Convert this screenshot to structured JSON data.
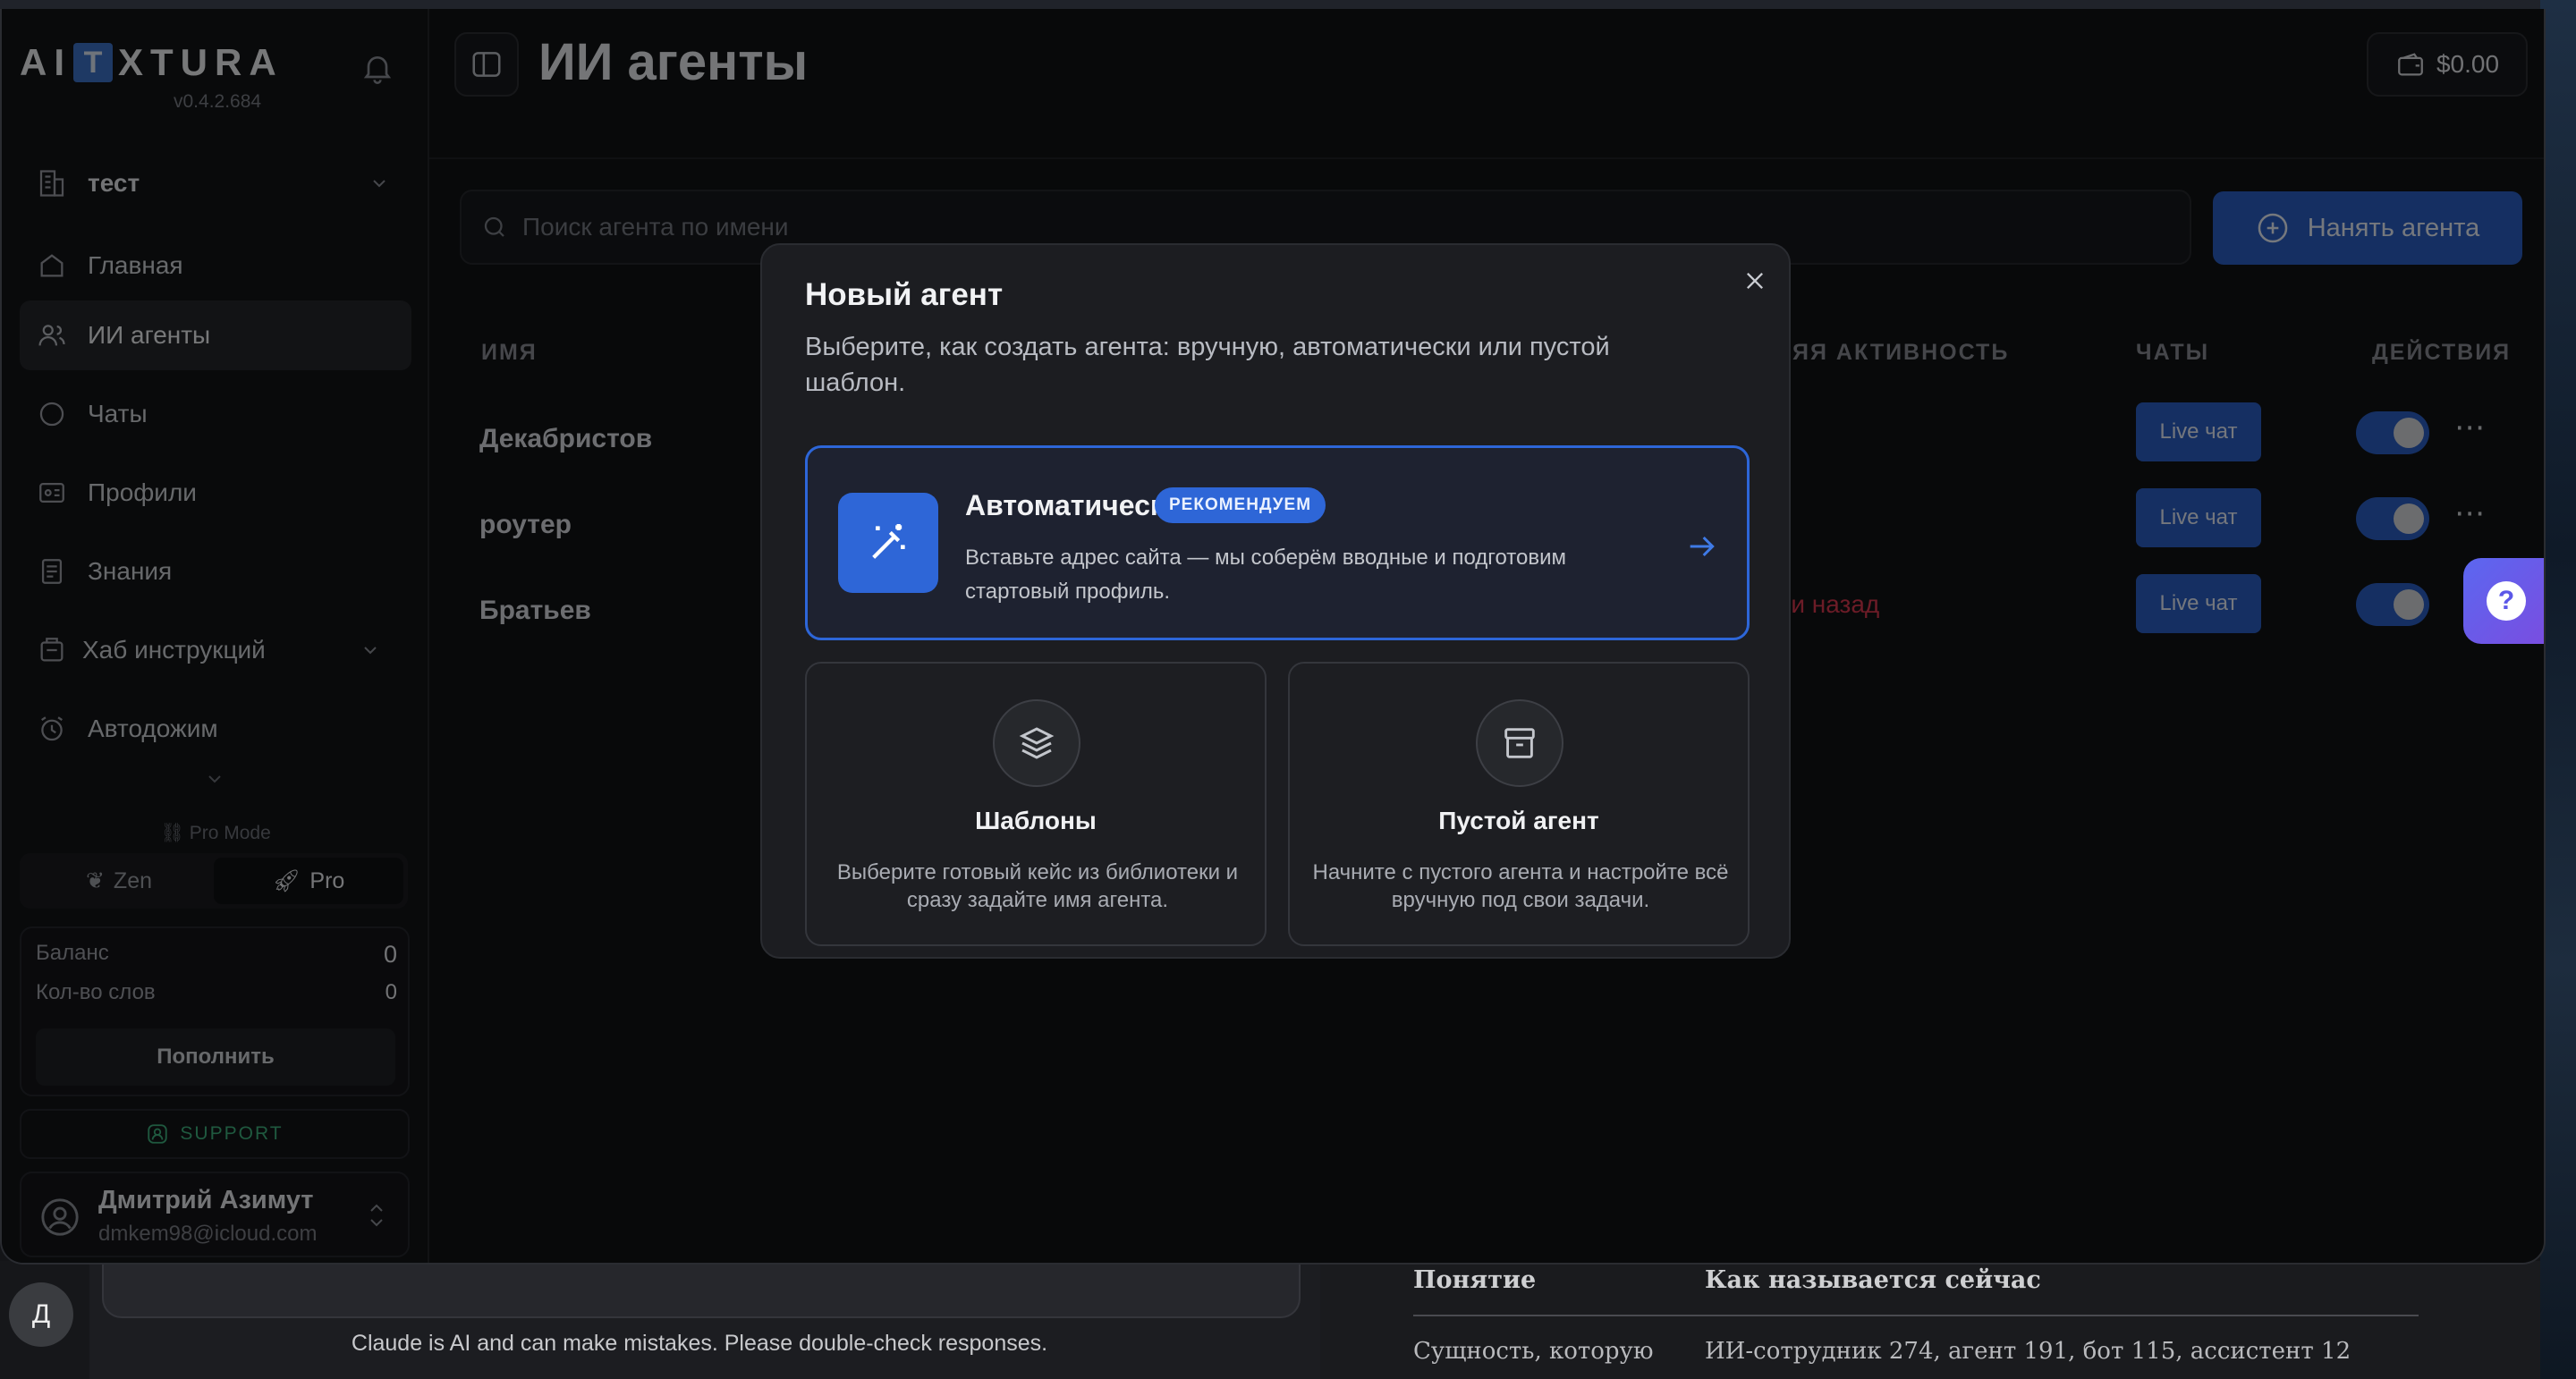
{
  "app": {
    "logo_left": "AI",
    "logo_box": "T",
    "logo_right": "XTURA",
    "version": "v0.4.2.684"
  },
  "sidebar": {
    "workspace": "тест",
    "items": [
      {
        "label": "Главная",
        "icon": "home-icon"
      },
      {
        "label": "ИИ агенты",
        "icon": "users-icon"
      },
      {
        "label": "Чаты",
        "icon": "chat-icon"
      },
      {
        "label": "Профили",
        "icon": "id-card-icon"
      },
      {
        "label": "Знания",
        "icon": "book-icon"
      },
      {
        "label": "Хаб инструкций",
        "icon": "hub-icon"
      },
      {
        "label": "Автодожим",
        "icon": "alarm-icon"
      }
    ],
    "pro_mode": "Pro Mode",
    "mode_zen": "Zen",
    "mode_pro": "Pro",
    "balance_label": "Баланс",
    "balance_value": "0",
    "words_label": "Кол-во слов",
    "words_value": "0",
    "topup": "Пополнить",
    "support": "SUPPORT",
    "user_name": "Дмитрий Азимут",
    "user_email": "dmkem98@icloud.com"
  },
  "header": {
    "title": "ИИ агенты",
    "wallet": "$0.00"
  },
  "search": {
    "placeholder": "Поиск агента по имени"
  },
  "hire_button": "Нанять агента",
  "table": {
    "col_name": "ИМЯ",
    "col_activity": "ЯЯ АКТИВНОСТЬ",
    "col_chats": "ЧАТЫ",
    "col_actions": "ДЕЙСТВИЯ",
    "rows": [
      {
        "name": "Декабристов",
        "chat": "Live чат"
      },
      {
        "name": "роутер",
        "chat": "Live чат"
      },
      {
        "name": "Братьев",
        "chat": "Live чат",
        "activity": "ли назад"
      }
    ]
  },
  "modal": {
    "title": "Новый агент",
    "subtitle": "Выберите, как создать агента: вручную, автоматически или пустой шаблон.",
    "auto_title": "Автоматически",
    "auto_badge": "РЕКОМЕНДУЕМ",
    "auto_desc": "Вставьте адрес сайта — мы соберём вводные и подготовим стартовый профиль.",
    "templates_title": "Шаблоны",
    "templates_desc": "Выберите готовый кейс из библиотеки и сразу задайте имя агента.",
    "empty_title": "Пустой агент",
    "empty_desc": "Начните с пустого агента и настройте всё вручную под свои задачи."
  },
  "background": {
    "avatar": "Д",
    "disclaimer": "Claude is AI and can make mistakes. Please double-check responses.",
    "doc_col1": "Понятие",
    "doc_col2": "Как называется сейчас",
    "doc_row_left": "Сущность, которую",
    "doc_row_right": "ИИ-сотрудник 274, агент 191, бот 115, ассистент 12"
  },
  "colors": {
    "accent": "#2b5fc5",
    "support": "#3fb27f",
    "danger": "#d8384f"
  }
}
